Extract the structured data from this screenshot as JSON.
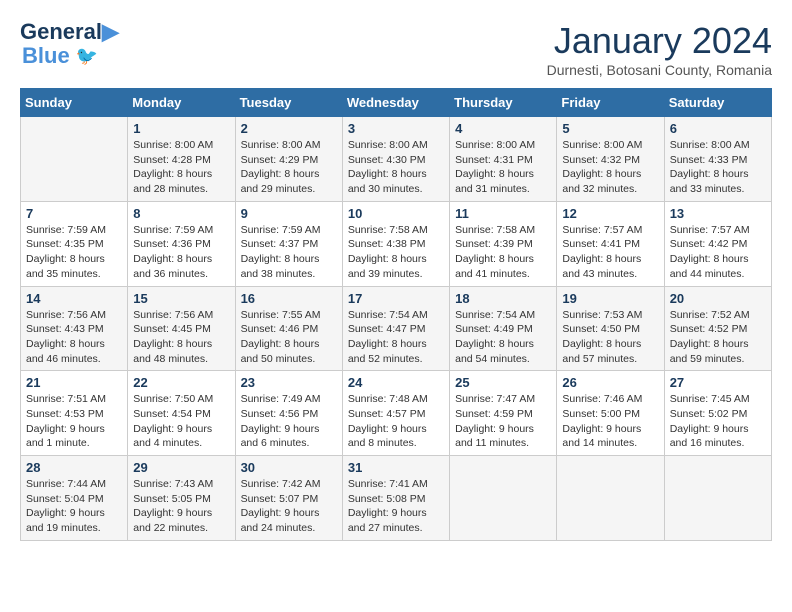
{
  "header": {
    "logo": {
      "part1": "General",
      "part2": "Blue"
    },
    "title": "January 2024",
    "location": "Durnesti, Botosani County, Romania"
  },
  "days_of_week": [
    "Sunday",
    "Monday",
    "Tuesday",
    "Wednesday",
    "Thursday",
    "Friday",
    "Saturday"
  ],
  "weeks": [
    {
      "days": [
        {
          "num": "",
          "info": ""
        },
        {
          "num": "1",
          "info": "Sunrise: 8:00 AM\nSunset: 4:28 PM\nDaylight: 8 hours\nand 28 minutes."
        },
        {
          "num": "2",
          "info": "Sunrise: 8:00 AM\nSunset: 4:29 PM\nDaylight: 8 hours\nand 29 minutes."
        },
        {
          "num": "3",
          "info": "Sunrise: 8:00 AM\nSunset: 4:30 PM\nDaylight: 8 hours\nand 30 minutes."
        },
        {
          "num": "4",
          "info": "Sunrise: 8:00 AM\nSunset: 4:31 PM\nDaylight: 8 hours\nand 31 minutes."
        },
        {
          "num": "5",
          "info": "Sunrise: 8:00 AM\nSunset: 4:32 PM\nDaylight: 8 hours\nand 32 minutes."
        },
        {
          "num": "6",
          "info": "Sunrise: 8:00 AM\nSunset: 4:33 PM\nDaylight: 8 hours\nand 33 minutes."
        }
      ]
    },
    {
      "days": [
        {
          "num": "7",
          "info": "Sunrise: 7:59 AM\nSunset: 4:35 PM\nDaylight: 8 hours\nand 35 minutes."
        },
        {
          "num": "8",
          "info": "Sunrise: 7:59 AM\nSunset: 4:36 PM\nDaylight: 8 hours\nand 36 minutes."
        },
        {
          "num": "9",
          "info": "Sunrise: 7:59 AM\nSunset: 4:37 PM\nDaylight: 8 hours\nand 38 minutes."
        },
        {
          "num": "10",
          "info": "Sunrise: 7:58 AM\nSunset: 4:38 PM\nDaylight: 8 hours\nand 39 minutes."
        },
        {
          "num": "11",
          "info": "Sunrise: 7:58 AM\nSunset: 4:39 PM\nDaylight: 8 hours\nand 41 minutes."
        },
        {
          "num": "12",
          "info": "Sunrise: 7:57 AM\nSunset: 4:41 PM\nDaylight: 8 hours\nand 43 minutes."
        },
        {
          "num": "13",
          "info": "Sunrise: 7:57 AM\nSunset: 4:42 PM\nDaylight: 8 hours\nand 44 minutes."
        }
      ]
    },
    {
      "days": [
        {
          "num": "14",
          "info": "Sunrise: 7:56 AM\nSunset: 4:43 PM\nDaylight: 8 hours\nand 46 minutes."
        },
        {
          "num": "15",
          "info": "Sunrise: 7:56 AM\nSunset: 4:45 PM\nDaylight: 8 hours\nand 48 minutes."
        },
        {
          "num": "16",
          "info": "Sunrise: 7:55 AM\nSunset: 4:46 PM\nDaylight: 8 hours\nand 50 minutes."
        },
        {
          "num": "17",
          "info": "Sunrise: 7:54 AM\nSunset: 4:47 PM\nDaylight: 8 hours\nand 52 minutes."
        },
        {
          "num": "18",
          "info": "Sunrise: 7:54 AM\nSunset: 4:49 PM\nDaylight: 8 hours\nand 54 minutes."
        },
        {
          "num": "19",
          "info": "Sunrise: 7:53 AM\nSunset: 4:50 PM\nDaylight: 8 hours\nand 57 minutes."
        },
        {
          "num": "20",
          "info": "Sunrise: 7:52 AM\nSunset: 4:52 PM\nDaylight: 8 hours\nand 59 minutes."
        }
      ]
    },
    {
      "days": [
        {
          "num": "21",
          "info": "Sunrise: 7:51 AM\nSunset: 4:53 PM\nDaylight: 9 hours\nand 1 minute."
        },
        {
          "num": "22",
          "info": "Sunrise: 7:50 AM\nSunset: 4:54 PM\nDaylight: 9 hours\nand 4 minutes."
        },
        {
          "num": "23",
          "info": "Sunrise: 7:49 AM\nSunset: 4:56 PM\nDaylight: 9 hours\nand 6 minutes."
        },
        {
          "num": "24",
          "info": "Sunrise: 7:48 AM\nSunset: 4:57 PM\nDaylight: 9 hours\nand 8 minutes."
        },
        {
          "num": "25",
          "info": "Sunrise: 7:47 AM\nSunset: 4:59 PM\nDaylight: 9 hours\nand 11 minutes."
        },
        {
          "num": "26",
          "info": "Sunrise: 7:46 AM\nSunset: 5:00 PM\nDaylight: 9 hours\nand 14 minutes."
        },
        {
          "num": "27",
          "info": "Sunrise: 7:45 AM\nSunset: 5:02 PM\nDaylight: 9 hours\nand 16 minutes."
        }
      ]
    },
    {
      "days": [
        {
          "num": "28",
          "info": "Sunrise: 7:44 AM\nSunset: 5:04 PM\nDaylight: 9 hours\nand 19 minutes."
        },
        {
          "num": "29",
          "info": "Sunrise: 7:43 AM\nSunset: 5:05 PM\nDaylight: 9 hours\nand 22 minutes."
        },
        {
          "num": "30",
          "info": "Sunrise: 7:42 AM\nSunset: 5:07 PM\nDaylight: 9 hours\nand 24 minutes."
        },
        {
          "num": "31",
          "info": "Sunrise: 7:41 AM\nSunset: 5:08 PM\nDaylight: 9 hours\nand 27 minutes."
        },
        {
          "num": "",
          "info": ""
        },
        {
          "num": "",
          "info": ""
        },
        {
          "num": "",
          "info": ""
        }
      ]
    }
  ]
}
